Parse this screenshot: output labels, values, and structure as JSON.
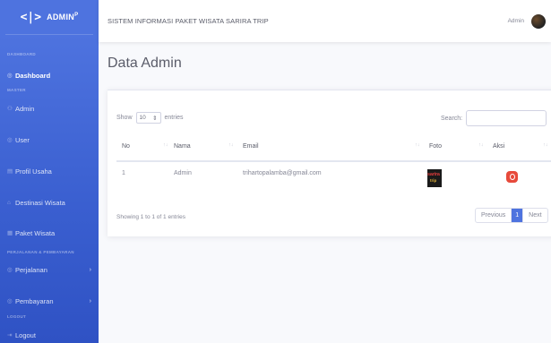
{
  "sidebar": {
    "brand": {
      "logo": "<|>",
      "title": "ADMIN",
      "sup": "P"
    },
    "headings": [
      "DASHBOARD",
      "MASTER",
      "PERJALANAN & PEMBAYARAN",
      "LOGOUT"
    ],
    "items": [
      {
        "label": "Dashboard",
        "icon": "dashboard-icon",
        "glyph": "◎"
      },
      {
        "label": "Admin",
        "icon": "user-icon",
        "glyph": "⚇"
      },
      {
        "label": "User",
        "icon": "users-icon",
        "glyph": "◎"
      },
      {
        "label": "Profil Usaha",
        "icon": "building-icon",
        "glyph": "▤"
      },
      {
        "label": "Destinasi Wisata",
        "icon": "map-pin-icon",
        "glyph": "⌂"
      },
      {
        "label": "Paket Wisata",
        "icon": "package-icon",
        "glyph": "▦"
      },
      {
        "label": "Perjalanan",
        "icon": "travel-icon",
        "glyph": "◎",
        "chevron": "›"
      },
      {
        "label": "Pembayaran",
        "icon": "payment-icon",
        "glyph": "◎",
        "chevron": "›"
      },
      {
        "label": "Logout",
        "icon": "logout-icon",
        "glyph": "⇥"
      }
    ]
  },
  "topbar": {
    "title": "SISTEM INFORMASI PAKET WISATA SARIRA TRIP",
    "user": "Admin"
  },
  "page": {
    "title": "Data Admin"
  },
  "table_controls": {
    "show": "Show",
    "entries_value": "10",
    "entries": "entries",
    "search_label": "Search:"
  },
  "table": {
    "headers": [
      "No",
      "Nama",
      "Email",
      "Foto",
      "Aksi"
    ],
    "rows": [
      {
        "no": "1",
        "nama": "Admin",
        "email": "trihartopalamba@gmail.com",
        "foto_line1": "sarira",
        "foto_line2": "trip"
      }
    ]
  },
  "footer": {
    "info": "Showing 1 to 1 of 1 entries",
    "previous": "Previous",
    "page": "1",
    "next": "Next"
  },
  "colors": {
    "primary": "#4e73df",
    "danger": "#e74a3b"
  }
}
